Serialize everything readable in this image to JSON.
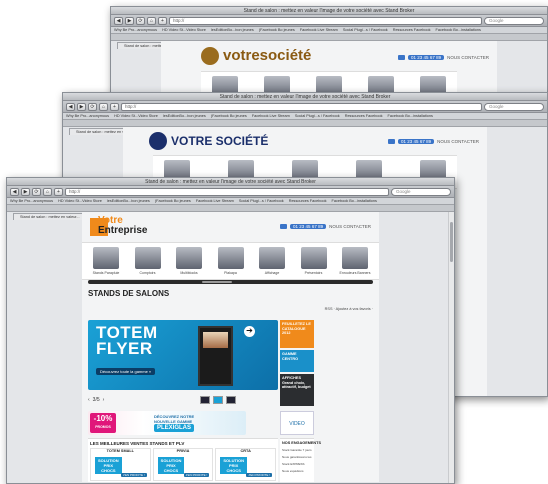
{
  "window_title": "Stand de salon : mettez en valeur l'image de votre société avec Stand Broker",
  "url": "http://",
  "search_placeholder": "Google",
  "bookmarks": [
    "Why Be Pro...anonymous",
    "HD Video St...Video Store",
    "lesEditionBo...bon jeunes",
    "(Facebook Bo jeunes",
    "Facebook Live Stream",
    "Social Plugi...s / Facebook",
    "Ressources Facebook",
    "Facebook Bo...installations"
  ],
  "tab_label": "Stand de salon : mettez en valeur...",
  "toolbar_buttons": [
    "◀",
    "▶",
    "⟳",
    "⌂",
    "+"
  ],
  "back_window": {
    "brand": "votresociété"
  },
  "mid_window": {
    "brand": "VOTRE SOCIÉTÉ"
  },
  "front_window": {
    "brand_line1": "Votre",
    "brand_line2": "Entreprise",
    "phone": "01 23 45 67 89",
    "contact_label": "NOUS CONTACTER",
    "categories": [
      "Stands Parapluie",
      "Comptoirs",
      "Multiblocks",
      "Plakapa",
      "Affichage",
      "Présentoirs",
      "Enrouleurs Banners"
    ],
    "section_title": "STANDS DE SALONS",
    "section_tools": "RSS · Ajoutez à vos favoris ·",
    "hero_title": "TOTEM\nFLYER",
    "hero_button": "Découvrez toute la gamme »",
    "pager": "3/5",
    "side_catalogue": "FEUILLETEZ LE CATALOGUE 2012",
    "side_gamme": "GAMME CENTRO",
    "side_affiches": "AFFICHES Grand choix, attractif, budget",
    "promo_badge": "-10%",
    "promo_badge_sub": "PROMOS",
    "promo_text": "DÉCOUVREZ NOTRE\nNOUVELLE GAMME",
    "promo_plex": "PLEXIGLAS",
    "video_label": "VIDEO",
    "best_sellers_title": "LES MEILLEURES VENTES STANDS ET PLV",
    "products": [
      {
        "name": "TOTEM SMALL",
        "badge": "SOLUTION\nPRIX\nCHOCS",
        "button": "J'EN PROFITE !"
      },
      {
        "name": "PRIVIA",
        "badge": "SOLUTION\nPRIX\nCHOCS",
        "button": "J'EN PROFITE !"
      },
      {
        "name": "CRTA",
        "badge": "SOLUTION\nPRIX\nCHOCS",
        "button": "J'EN PROFITE !"
      }
    ],
    "engagements_title": "NOS ENGAGEMENTS",
    "engagements": [
      "Stock Garantie 7 jours",
      "Nous garantissons les délais",
      "Stock EXPRESS",
      "Nous expédions"
    ]
  },
  "colors": {
    "accent": "#1aa1d6",
    "orange": "#f08a1b",
    "magenta": "#e0177a",
    "navy": "#1d6fa8"
  }
}
